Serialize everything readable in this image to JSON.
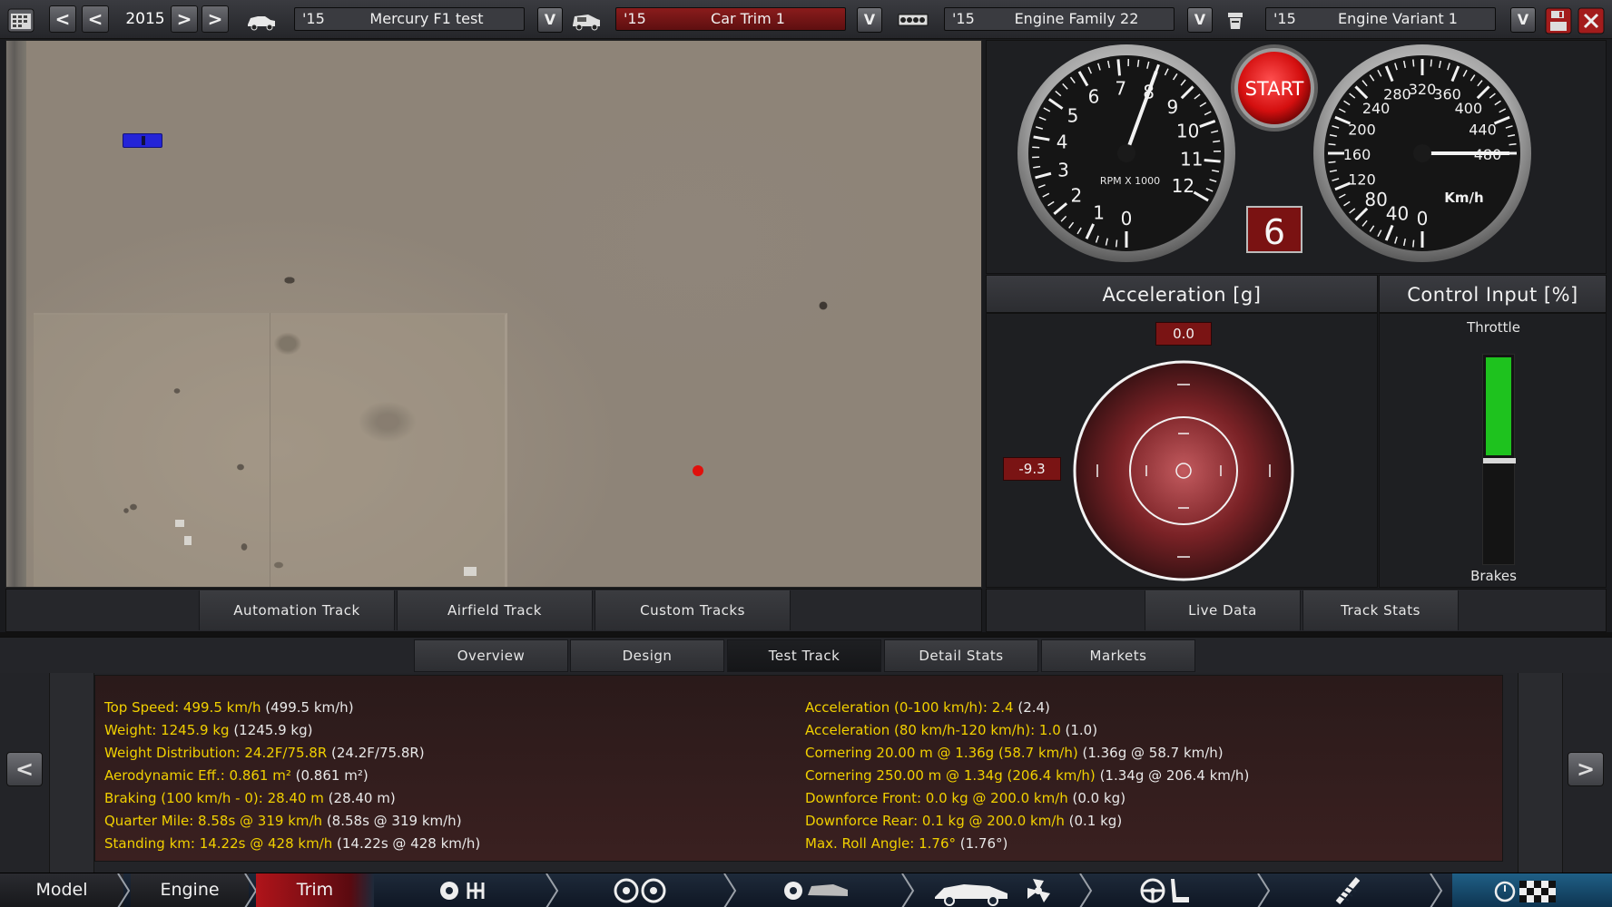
{
  "topbar": {
    "year": "2015",
    "model": {
      "year": "'15",
      "name": "Mercury F1 test"
    },
    "trim": {
      "year": "'15",
      "name": "Car Trim 1"
    },
    "engine_family": {
      "year": "'15",
      "name": "Engine Family 22"
    },
    "engine_variant": {
      "year": "'15",
      "name": "Engine Variant 1"
    },
    "prev_label": "<",
    "next_label": ">",
    "dropdown_label": "V"
  },
  "track_tabs": [
    "Automation Track",
    "Airfield Track",
    "Custom Tracks"
  ],
  "data_tabs": [
    "Live Data",
    "Track Stats"
  ],
  "tachometer": {
    "ticks": [
      "0",
      "1",
      "2",
      "3",
      "4",
      "5",
      "6",
      "7",
      "8",
      "9",
      "10",
      "11",
      "12"
    ],
    "label": "RPM X 1000",
    "value_rpm_thousands": 8.0
  },
  "speedometer": {
    "ticks": [
      "0",
      "40",
      "80",
      "120",
      "160",
      "200",
      "240",
      "280",
      "320",
      "360",
      "400",
      "440",
      "480"
    ],
    "label": "Km/h",
    "value_kmh": 480
  },
  "start_button": "START",
  "gear": "6",
  "acceleration": {
    "title": "Acceleration [g]",
    "longitudinal": "0.0",
    "lateral": "-9.3"
  },
  "control_input": {
    "title": "Control Input [%]",
    "throttle_label": "Throttle",
    "brakes_label": "Brakes",
    "throttle_fraction": 1.0,
    "brakes_fraction": 0.0,
    "throttle_color": "#1ec21e"
  },
  "main_tabs": [
    "Overview",
    "Design",
    "Test Track",
    "Detail Stats",
    "Markets"
  ],
  "active_tab": "Test Track",
  "stats": {
    "left": [
      {
        "label": "Top Speed: 499.5 km/h",
        "value": " (499.5 km/h)"
      },
      {
        "label": "Weight: 1245.9 kg",
        "value": " (1245.9 kg)"
      },
      {
        "label": "Weight Distribution: 24.2F/75.8R",
        "value": " (24.2F/75.8R)"
      },
      {
        "label": "Aerodynamic Eff.: 0.861 m²",
        "value": " (0.861 m²)"
      },
      {
        "label": "Braking (100 km/h - 0): 28.40 m",
        "value": " (28.40 m)"
      },
      {
        "label": "Quarter Mile: 8.58s @ 319 km/h",
        "value": " (8.58s @ 319 km/h)"
      },
      {
        "label": "Standing km: 14.22s @ 428 km/h",
        "value": " (14.22s @ 428 km/h)"
      }
    ],
    "right": [
      {
        "label": "Acceleration (0-100 km/h): 2.4",
        "value": " (2.4)"
      },
      {
        "label": "Acceleration (80 km/h-120 km/h): 1.0",
        "value": " (1.0)"
      },
      {
        "label": "Cornering 20.00 m @ 1.36g (58.7 km/h)",
        "value": " (1.36g @ 58.7 km/h)"
      },
      {
        "label": "Cornering 250.00 m @ 1.34g (206.4 km/h)",
        "value": " (1.34g @ 206.4 km/h)"
      },
      {
        "label": "Downforce Front: 0.0 kg @ 200.0 km/h",
        "value": " (0.0 kg)"
      },
      {
        "label": "Downforce Rear: 0.1 kg @ 200.0 km/h",
        "value": " (0.1 kg)"
      },
      {
        "label": "Max. Roll Angle: 1.76°",
        "value": " (1.76°)"
      }
    ]
  },
  "bottom_nav": {
    "model": "Model",
    "engine": "Engine",
    "trim": "Trim"
  },
  "colors": {
    "stat_label": "#f1d000",
    "active_nav": "#b0141a",
    "start_red": "#e01010"
  }
}
